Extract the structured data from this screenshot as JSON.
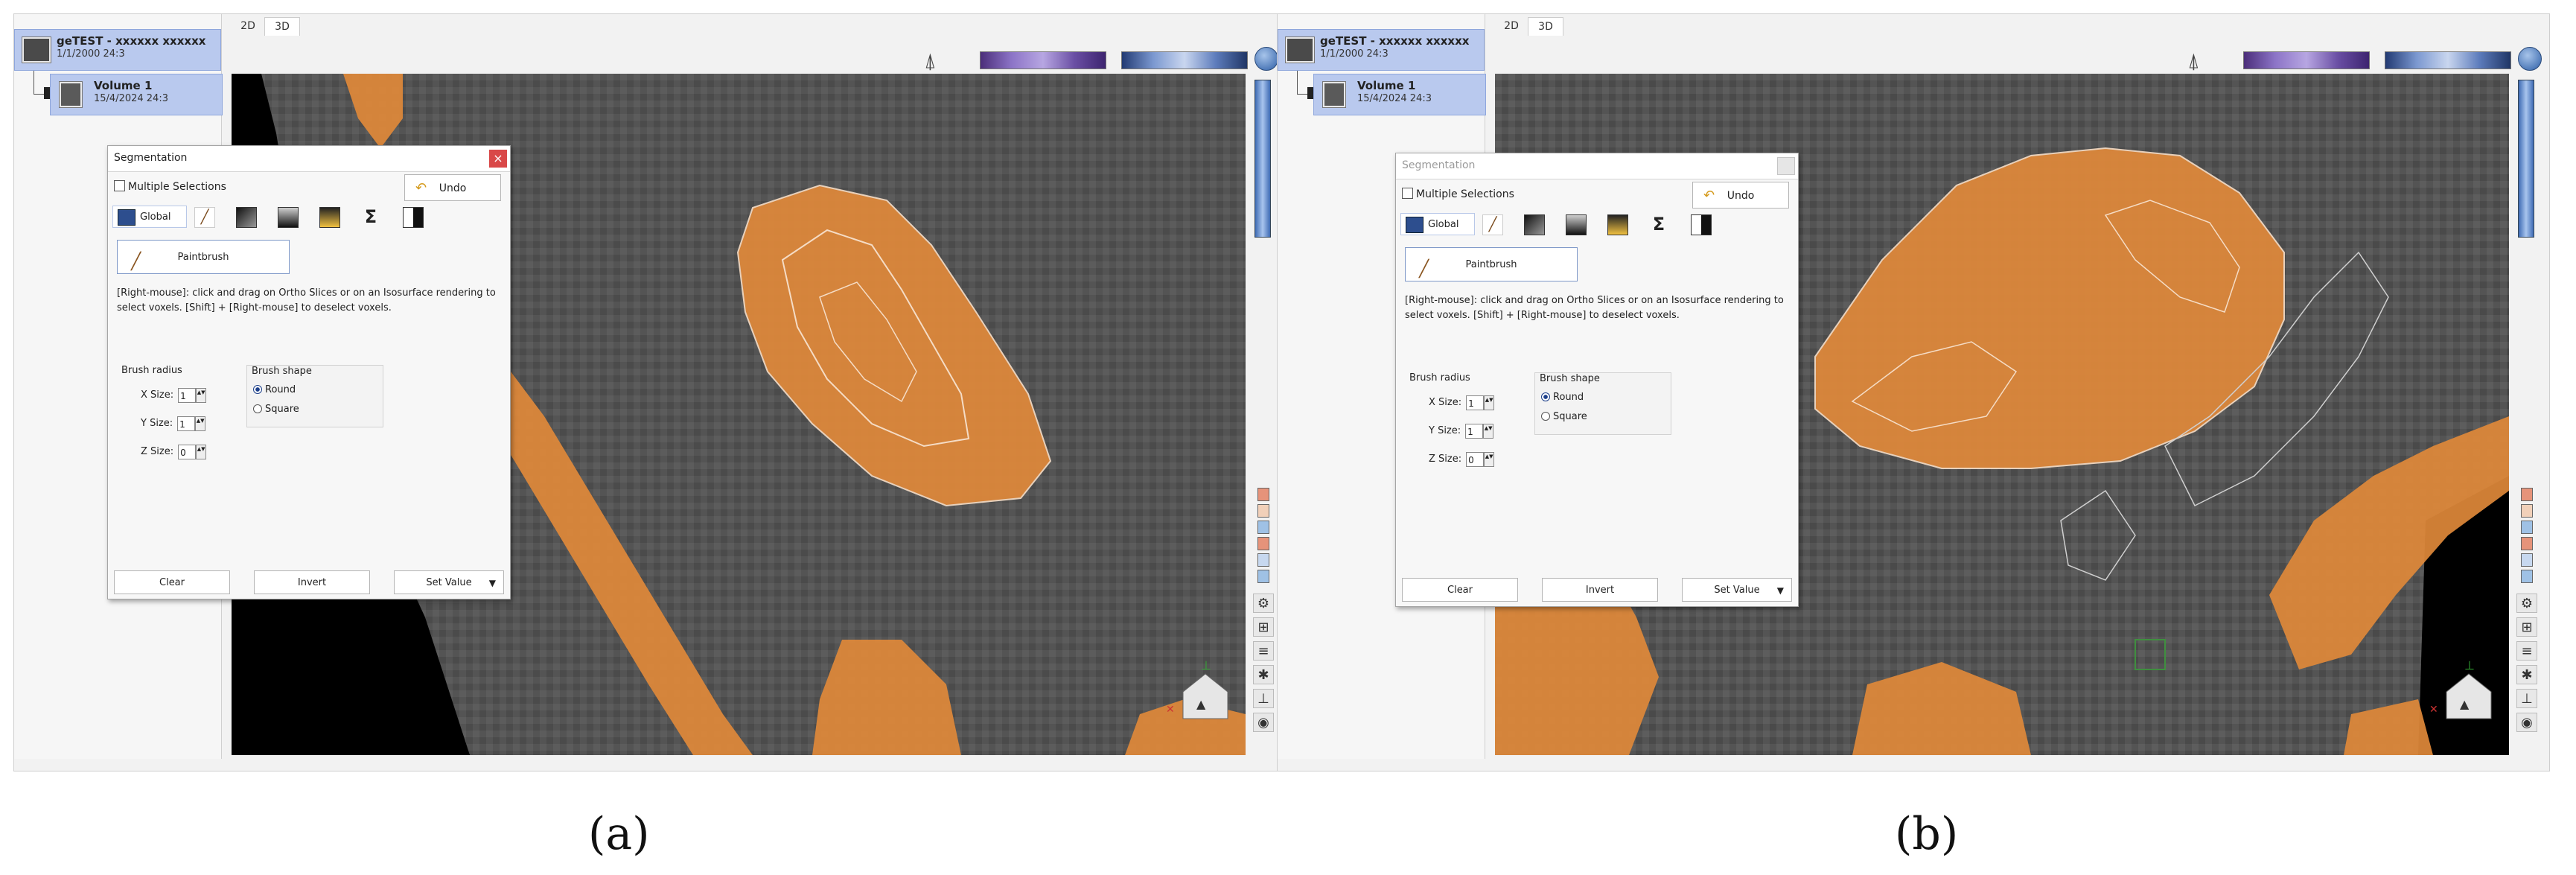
{
  "panels": [
    {
      "id": "a",
      "caption": "(a)",
      "tree": {
        "root_title": "geTEST - xxxxxx xxxxxx",
        "root_sub": "1/1/2000  24:3",
        "volume_title": "Volume 1",
        "volume_sub": "15/4/2024  24:3"
      },
      "tabs": [
        "2D",
        "3D"
      ],
      "active_tab": "3D",
      "dialog": {
        "title": "Segmentation",
        "active": true,
        "multiple_selections": "Multiple Selections",
        "undo": "Undo",
        "global": "Global",
        "paintbrush": "Paintbrush",
        "help_text": "[Right-mouse]: click and drag on Ortho Slices or on an Isosurface rendering to select voxels. [Shift] + [Right-mouse] to deselect voxels.",
        "brush_radius_label": "Brush radius",
        "x_size_label": "X Size:",
        "y_size_label": "Y Size:",
        "z_size_label": "Z Size:",
        "x_size": "1",
        "y_size": "1",
        "z_size": "0",
        "brush_shape_label": "Brush shape",
        "shape_round": "Round",
        "shape_square": "Square",
        "clear": "Clear",
        "invert": "Invert",
        "set_value": "Set Value"
      }
    },
    {
      "id": "b",
      "caption": "(b)",
      "tree": {
        "root_title": "geTEST - xxxxxx xxxxxx",
        "root_sub": "1/1/2000  24:3",
        "volume_title": "Volume 1",
        "volume_sub": "15/4/2024  24:3"
      },
      "tabs": [
        "2D",
        "3D"
      ],
      "active_tab": "3D",
      "dialog": {
        "title": "Segmentation",
        "active": false,
        "multiple_selections": "Multiple Selections",
        "undo": "Undo",
        "global": "Global",
        "paintbrush": "Paintbrush",
        "help_text": "[Right-mouse]: click and drag on Ortho Slices or on an Isosurface rendering to select voxels. [Shift] + [Right-mouse] to deselect voxels.",
        "brush_radius_label": "Brush radius",
        "x_size_label": "X Size:",
        "y_size_label": "Y Size:",
        "z_size_label": "Z Size:",
        "x_size": "1",
        "y_size": "1",
        "z_size": "0",
        "brush_shape_label": "Brush shape",
        "shape_round": "Round",
        "shape_square": "Square",
        "clear": "Clear",
        "invert": "Invert",
        "set_value": "Set Value"
      }
    }
  ],
  "icons": {
    "sigma": "Σ",
    "close": "×",
    "dropdown": "▼",
    "spin": "▲▼"
  },
  "colors": {
    "segmentation_orange": "#e0893a",
    "tissue_gray": "#555555",
    "selection_blue": "#b9c9ee",
    "close_red": "#d94848"
  }
}
